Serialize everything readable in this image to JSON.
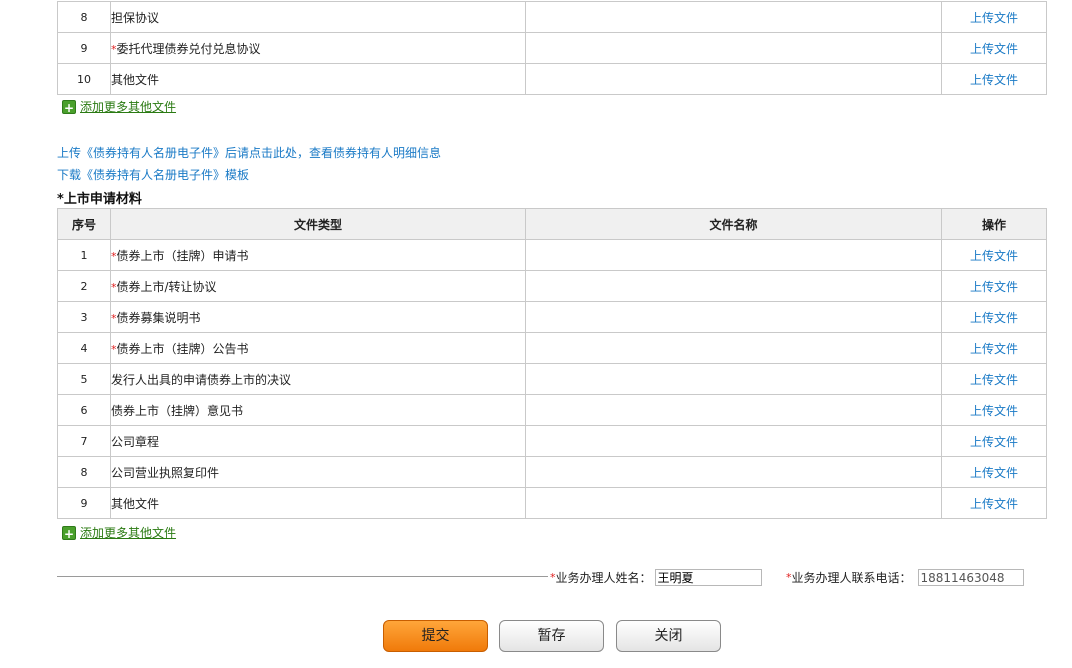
{
  "table1": {
    "rows": [
      {
        "num": "8",
        "required": false,
        "type": "担保协议",
        "name": "",
        "action": "上传文件"
      },
      {
        "num": "9",
        "required": true,
        "type": "委托代理债券兑付兑息协议",
        "name": "",
        "action": "上传文件"
      },
      {
        "num": "10",
        "required": false,
        "type": "其他文件",
        "name": "",
        "action": "上传文件"
      }
    ],
    "add_more": "添加更多其他文件"
  },
  "links": {
    "upload_holders": "上传《债券持有人名册电子件》后请点击此处，查看债券持有人明细信息",
    "download_template": "下载《债券持有人名册电子件》模板"
  },
  "section2": {
    "title": "上市申请材料",
    "required_mark": "*",
    "headers": [
      "序号",
      "文件类型",
      "文件名称",
      "操作"
    ],
    "rows": [
      {
        "num": "1",
        "required": true,
        "type": "债券上市（挂牌）申请书",
        "name": "",
        "action": "上传文件"
      },
      {
        "num": "2",
        "required": true,
        "type": "债券上市/转让协议",
        "name": "",
        "action": "上传文件"
      },
      {
        "num": "3",
        "required": true,
        "type": "债券募集说明书",
        "name": "",
        "action": "上传文件"
      },
      {
        "num": "4",
        "required": true,
        "type": "债券上市（挂牌）公告书",
        "name": "",
        "action": "上传文件"
      },
      {
        "num": "5",
        "required": false,
        "type": "发行人出具的申请债券上市的决议",
        "name": "",
        "action": "上传文件"
      },
      {
        "num": "6",
        "required": false,
        "type": "债券上市（挂牌）意见书",
        "name": "",
        "action": "上传文件"
      },
      {
        "num": "7",
        "required": false,
        "type": "公司章程",
        "name": "",
        "action": "上传文件"
      },
      {
        "num": "8",
        "required": false,
        "type": "公司营业执照复印件",
        "name": "",
        "action": "上传文件"
      },
      {
        "num": "9",
        "required": false,
        "type": "其他文件",
        "name": "",
        "action": "上传文件"
      }
    ],
    "add_more": "添加更多其他文件"
  },
  "contact": {
    "name_label": "业务办理人姓名：",
    "name_value": "王明夏",
    "phone_label": "业务办理人联系电话：",
    "phone_value": "18811463048"
  },
  "buttons": {
    "submit": "提交",
    "save": "暂存",
    "close": "关闭"
  },
  "colors": {
    "link": "#1a7ac6",
    "required": "#e02020",
    "add_link": "#2a7a12",
    "primary_button": "#f07a0a"
  }
}
